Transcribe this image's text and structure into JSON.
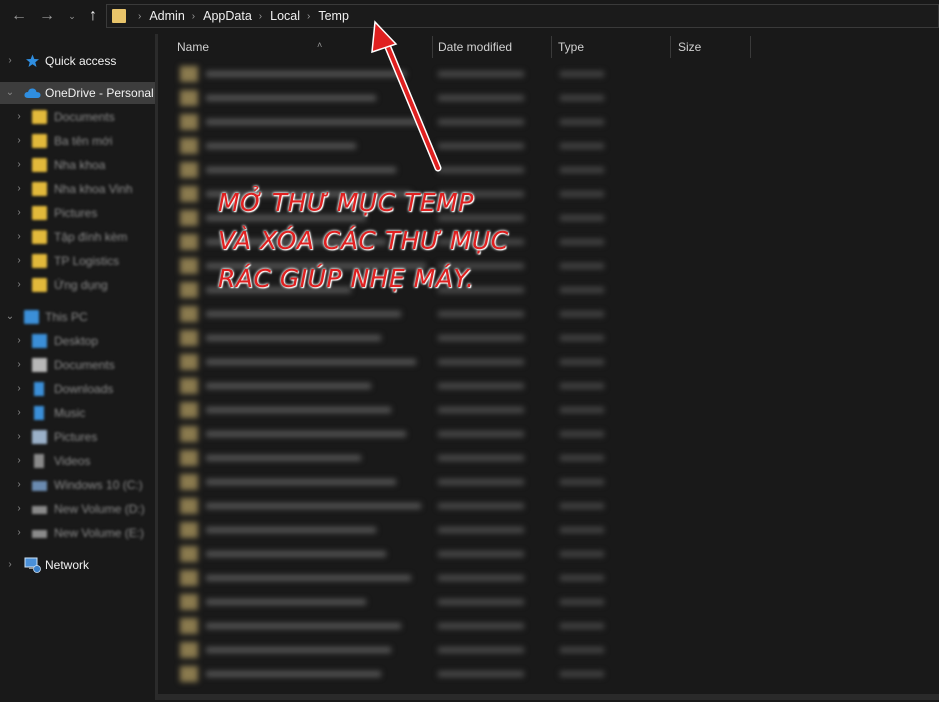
{
  "nav_buttons": {
    "back": "←",
    "forward": "→",
    "recent": "⌄",
    "up": "↑"
  },
  "address": {
    "crumbs": [
      "Admin",
      "AppData",
      "Local",
      "Temp"
    ],
    "separator": "›"
  },
  "sidebar": {
    "quick_access": "Quick access",
    "onedrive": "OneDrive - Personal",
    "onedrive_children": [
      "Documents",
      "Ba tên mới",
      "Nha khoa",
      "Nha khoa Vinh",
      "Pictures",
      "Tập đính kèm",
      "TP Logistics",
      "Ứng dụng"
    ],
    "this_pc": "This PC",
    "this_pc_children": [
      "Desktop",
      "Documents",
      "Downloads",
      "Music",
      "Pictures",
      "Videos",
      "Windows 10 (C:)",
      "New Volume (D:)",
      "New Volume (E:)"
    ],
    "network": "Network"
  },
  "columns": {
    "name": "Name",
    "date_modified": "Date modified",
    "type": "Type",
    "size": "Size"
  },
  "annotation": {
    "line1": "MỞ THƯ MỤC TEMP",
    "line2": "VÀ XÓA CÁC THƯ MỤC",
    "line3": "RÁC GIÚP NHẸ MÁY.",
    "color": "#e02020"
  },
  "colors": {
    "background": "#191919",
    "selected": "#3d3d3d",
    "folder": "#e2b93b",
    "onedrive_icon": "#2f8ee0",
    "quick_access_icon": "#2f8ee0"
  }
}
